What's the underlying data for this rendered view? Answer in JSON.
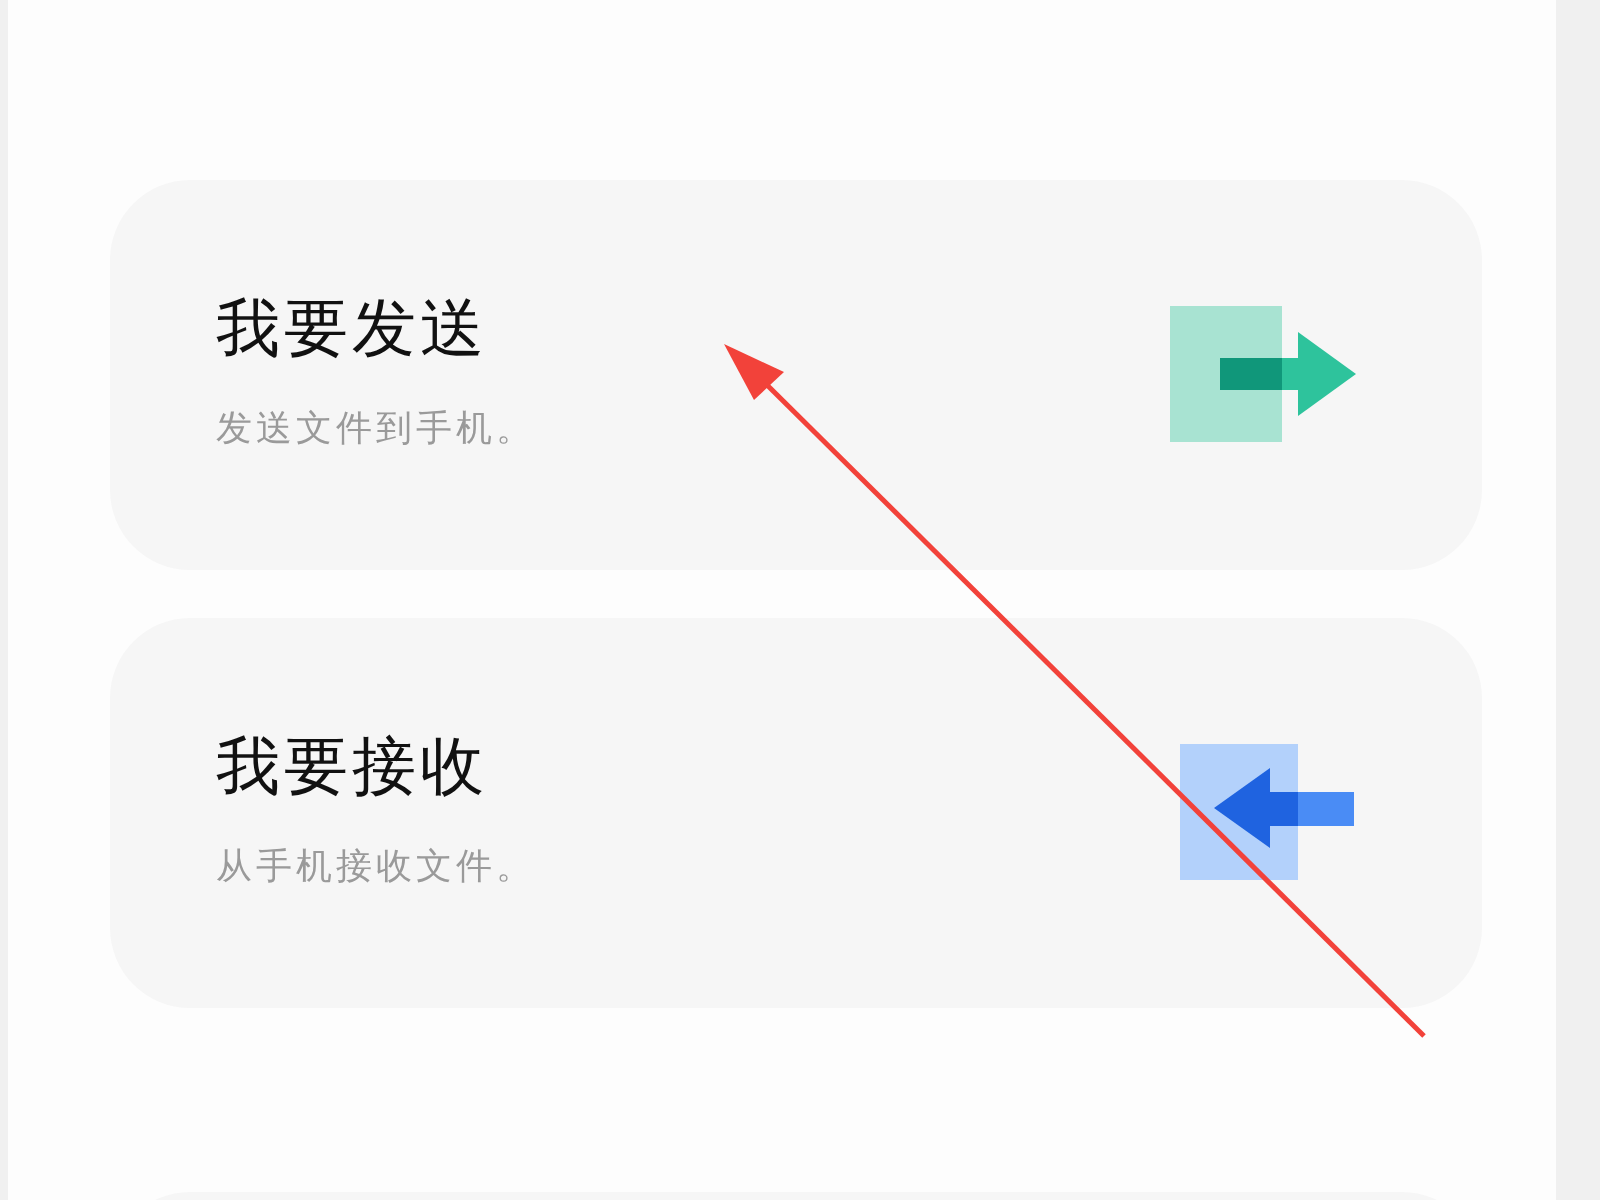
{
  "options": [
    {
      "kind": "send",
      "title": "我要发送",
      "subtitle": "发送文件到手机。"
    },
    {
      "kind": "receive",
      "title": "我要接收",
      "subtitle": "从手机接收文件。"
    }
  ]
}
